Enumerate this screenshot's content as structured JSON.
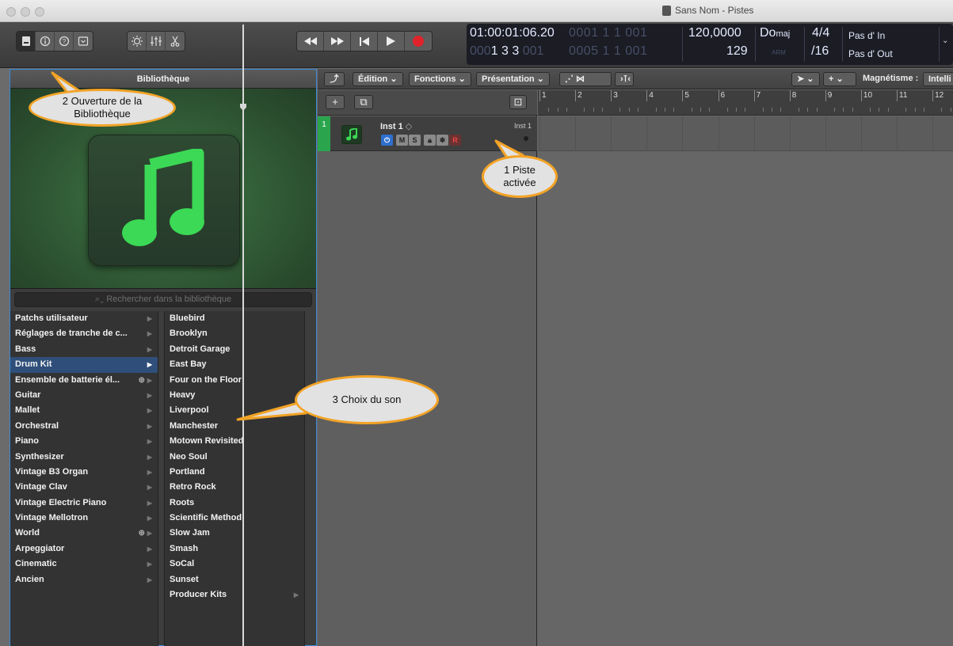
{
  "window": {
    "title": "Sans Nom - Pistes"
  },
  "toolbar": {
    "view_buttons": [
      "library-icon",
      "info-icon",
      "help-icon",
      "editor-icon"
    ],
    "edit_buttons": [
      "brightness-icon",
      "mixer-icon",
      "scissors-icon"
    ],
    "transport": [
      "rewind-icon",
      "forward-icon",
      "to-start-icon",
      "play-icon",
      "record-icon"
    ]
  },
  "lcd": {
    "time_main": "01:00:01:06.20",
    "time_dim": "0001 1 1 001",
    "bars_main": "1 3 3",
    "bars_dim_prefix": "000",
    "bars_tick": "001",
    "bars_end_dim": "0005 1 1 001",
    "tempo": "120,0000",
    "tempo_sub": "129",
    "key": "Do",
    "key_mode": "maj",
    "arm": "ARM",
    "sig_top": "4/4",
    "sig_bottom": "/16",
    "in_label": "Pas d' In",
    "out_label": "Pas d' Out"
  },
  "library": {
    "title": "Bibliothèque",
    "search_placeholder": "Rechercher dans la bibliothèque",
    "categories": [
      {
        "label": "Patchs utilisateur",
        "selected": false,
        "download": false
      },
      {
        "label": "Réglages de tranche de c...",
        "selected": false,
        "download": false
      },
      {
        "label": "Bass",
        "selected": false,
        "download": false
      },
      {
        "label": "Drum Kit",
        "selected": true,
        "download": false
      },
      {
        "label": "Ensemble de batterie él...",
        "selected": false,
        "download": true
      },
      {
        "label": "Guitar",
        "selected": false,
        "download": false
      },
      {
        "label": "Mallet",
        "selected": false,
        "download": false
      },
      {
        "label": "Orchestral",
        "selected": false,
        "download": false
      },
      {
        "label": "Piano",
        "selected": false,
        "download": false
      },
      {
        "label": "Synthesizer",
        "selected": false,
        "download": false
      },
      {
        "label": "Vintage B3 Organ",
        "selected": false,
        "download": false
      },
      {
        "label": "Vintage Clav",
        "selected": false,
        "download": false
      },
      {
        "label": "Vintage Electric Piano",
        "selected": false,
        "download": false
      },
      {
        "label": "Vintage Mellotron",
        "selected": false,
        "download": false
      },
      {
        "label": "World",
        "selected": false,
        "download": true
      },
      {
        "label": "Arpeggiator",
        "selected": false,
        "download": false
      },
      {
        "label": "Cinematic",
        "selected": false,
        "download": false
      },
      {
        "label": "Ancien",
        "selected": false,
        "download": false
      }
    ],
    "patches": [
      {
        "label": "Bluebird",
        "folder": false
      },
      {
        "label": "Brooklyn",
        "folder": false
      },
      {
        "label": "Detroit Garage",
        "folder": false
      },
      {
        "label": "East Bay",
        "folder": false
      },
      {
        "label": "Four on the Floor",
        "folder": false
      },
      {
        "label": "Heavy",
        "folder": false
      },
      {
        "label": "Liverpool",
        "folder": false
      },
      {
        "label": "Manchester",
        "folder": false
      },
      {
        "label": "Motown Revisited",
        "folder": false
      },
      {
        "label": "Neo Soul",
        "folder": false
      },
      {
        "label": "Portland",
        "folder": false
      },
      {
        "label": "Retro Rock",
        "folder": false
      },
      {
        "label": "Roots",
        "folder": false
      },
      {
        "label": "Scientific Method",
        "folder": false
      },
      {
        "label": "Slow Jam",
        "folder": false
      },
      {
        "label": "Smash",
        "folder": false
      },
      {
        "label": "SoCal",
        "folder": false
      },
      {
        "label": "Sunset",
        "folder": false
      },
      {
        "label": "Producer Kits",
        "folder": true
      }
    ]
  },
  "tracks_toolbar": {
    "edit_menu": "Édition",
    "functions_menu": "Fonctions",
    "view_menu": "Présentation",
    "snap_label": "Magnétisme :",
    "snap_value": "Intelli"
  },
  "track": {
    "number": "1",
    "name": "Inst 1",
    "name_right": "Inst 1",
    "buttons": {
      "mute": "M",
      "solo": "S",
      "record": "R"
    }
  },
  "ruler": {
    "bars": [
      "1",
      "2",
      "3",
      "4",
      "5",
      "6",
      "7",
      "8",
      "9",
      "10",
      "11",
      "12"
    ]
  },
  "annotations": {
    "library_open": "2 Ouverture de la Bibliothèque",
    "track_active": "1 Piste activée",
    "sound_choice": "3 Choix du son",
    "accent": "#f3a326"
  }
}
